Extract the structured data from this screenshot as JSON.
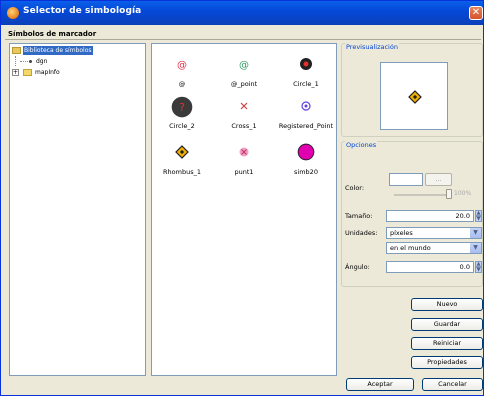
{
  "window": {
    "title": "Selector de simbología",
    "close_glyph": "✕"
  },
  "header": {
    "label": "Símbolos de marcador"
  },
  "tree": {
    "root": "Biblioteca de símbolos",
    "children": [
      "dgn",
      "mapInfo"
    ],
    "expander": "+"
  },
  "symbols": [
    {
      "name": "@",
      "icon": "at-sign-red-icon",
      "color": "#e0304a"
    },
    {
      "name": "@_point",
      "icon": "at-sign-green-icon",
      "color": "#30a060"
    },
    {
      "name": "Circle_1",
      "icon": "circle-dark-red-dot-icon",
      "color": "#202020"
    },
    {
      "name": "Circle_2",
      "icon": "circle-question-icon",
      "color": "#3a3a3a"
    },
    {
      "name": "Cross_1",
      "icon": "cross-icon",
      "color": "#d04040"
    },
    {
      "name": "Registered_Point",
      "icon": "registered-icon",
      "color": "#6040e0"
    },
    {
      "name": "Rhombus_1",
      "icon": "rhombus-icon",
      "color": "#f0b000"
    },
    {
      "name": "punt1",
      "icon": "pink-cross-circle-icon",
      "color": "#e070a0"
    },
    {
      "name": "simb20",
      "icon": "magenta-circle-icon",
      "color": "#e000b0"
    }
  ],
  "preview": {
    "title": "Previsualización",
    "icon": "rhombus-icon"
  },
  "options": {
    "title": "Opciones",
    "color_label": "Color:",
    "color_button": "...",
    "slider_value": "100%",
    "size_label": "Tamaño:",
    "size_value": "20.0",
    "units_label": "Unidades:",
    "units_value": "píxeles",
    "units_scope": "en el mundo",
    "angle_label": "Ángulo:",
    "angle_value": "0.0"
  },
  "actions": {
    "nuevo": "Nuevo",
    "guardar": "Guardar",
    "reiniciar": "Reiniciar",
    "propiedades": "Propiedades",
    "aceptar": "Aceptar",
    "cancelar": "Cancelar"
  },
  "colors": {
    "titlebar": "#0549d8",
    "selection": "#316ac5",
    "group_title": "#0046d5"
  }
}
